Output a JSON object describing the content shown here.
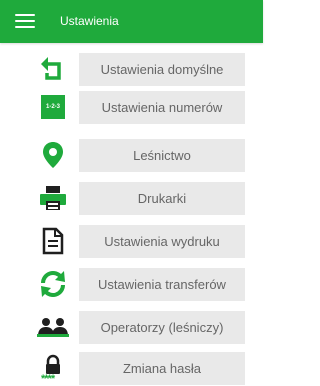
{
  "app_bar": {
    "title": "Ustawienia",
    "menu_icon": "hamburger-menu-icon"
  },
  "colors": {
    "accent": "#1faa3c",
    "button_bg": "#e9e9e9",
    "button_text": "#666666",
    "icon_dark": "#1f1f1f"
  },
  "settings_items": [
    {
      "label": "Ustawienia domyślne",
      "icon": "reset-arrow-icon"
    },
    {
      "label": "Ustawienia numerów",
      "icon": "numbering-icon",
      "icon_text": "1-2-3"
    },
    {
      "label": "Leśnictwo",
      "icon": "location-pin-icon"
    },
    {
      "label": "Drukarki",
      "icon": "printer-icon"
    },
    {
      "label": "Ustawienia wydruku",
      "icon": "document-icon"
    },
    {
      "label": "Ustawienia transferów",
      "icon": "sync-icon"
    },
    {
      "label": "Operatorzy (leśniczy)",
      "icon": "operators-icon"
    },
    {
      "label": "Zmiana hasła",
      "icon": "password-lock-icon",
      "icon_text": "****"
    }
  ]
}
